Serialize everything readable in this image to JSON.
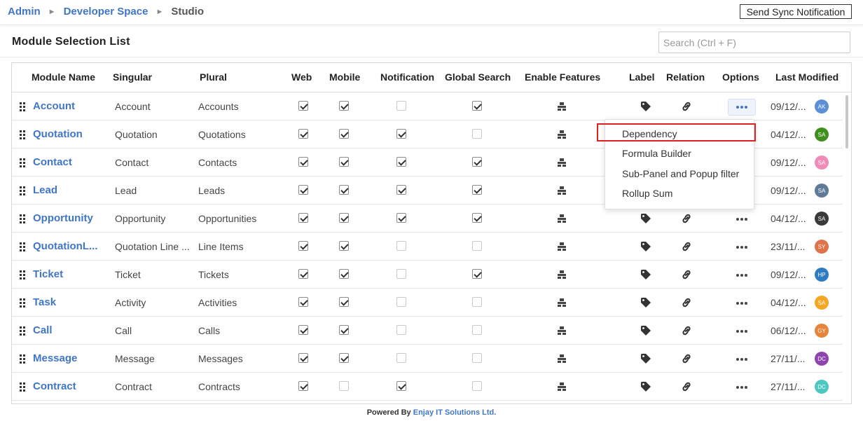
{
  "breadcrumb": [
    "Admin",
    "Developer Space",
    "Studio"
  ],
  "send_sync_label": "Send Sync Notification",
  "page_title": "Module Selection List",
  "search_placeholder": "Search (Ctrl + F)",
  "columns": [
    "Module Name",
    "Singular",
    "Plural",
    "Web",
    "Mobile",
    "Notification",
    "Global Search",
    "Enable Features",
    "Label",
    "Relation",
    "Options",
    "Last Modified"
  ],
  "rows": [
    {
      "name": "Account",
      "singular": "Account",
      "plural": "Accounts",
      "web": true,
      "mobile": true,
      "notification": false,
      "global_search": true,
      "modified": "09/12/...",
      "initials": "AK",
      "avatar_color": "#5b8fd6"
    },
    {
      "name": "Quotation",
      "singular": "Quotation",
      "plural": "Quotations",
      "web": true,
      "mobile": true,
      "notification": true,
      "global_search": false,
      "modified": "04/12/...",
      "initials": "SA",
      "avatar_color": "#3f8f1f"
    },
    {
      "name": "Contact",
      "singular": "Contact",
      "plural": "Contacts",
      "web": true,
      "mobile": true,
      "notification": true,
      "global_search": true,
      "modified": "09/12/...",
      "initials": "SA",
      "avatar_color": "#f28ab8"
    },
    {
      "name": "Lead",
      "singular": "Lead",
      "plural": "Leads",
      "web": true,
      "mobile": true,
      "notification": true,
      "global_search": true,
      "modified": "09/12/...",
      "initials": "SA",
      "avatar_color": "#5f7a99"
    },
    {
      "name": "Opportunity",
      "singular": "Opportunity",
      "plural": "Opportunities",
      "web": true,
      "mobile": true,
      "notification": true,
      "global_search": true,
      "modified": "04/12/...",
      "initials": "SA",
      "avatar_color": "#3a3a3a"
    },
    {
      "name": "QuotationL...",
      "singular": "Quotation Line ...",
      "plural": "Line Items",
      "web": true,
      "mobile": true,
      "notification": false,
      "global_search": false,
      "modified": "23/11/...",
      "initials": "SY",
      "avatar_color": "#e0734a"
    },
    {
      "name": "Ticket",
      "singular": "Ticket",
      "plural": "Tickets",
      "web": true,
      "mobile": true,
      "notification": false,
      "global_search": true,
      "modified": "09/12/...",
      "initials": "HP",
      "avatar_color": "#2e7bc4"
    },
    {
      "name": "Task",
      "singular": "Activity",
      "plural": "Activities",
      "web": true,
      "mobile": true,
      "notification": false,
      "global_search": false,
      "modified": "04/12/...",
      "initials": "SA",
      "avatar_color": "#f5a623"
    },
    {
      "name": "Call",
      "singular": "Call",
      "plural": "Calls",
      "web": true,
      "mobile": true,
      "notification": false,
      "global_search": false,
      "modified": "06/12/...",
      "initials": "GY",
      "avatar_color": "#e8833a"
    },
    {
      "name": "Message",
      "singular": "Message",
      "plural": "Messages",
      "web": true,
      "mobile": true,
      "notification": false,
      "global_search": false,
      "modified": "27/11/...",
      "initials": "DC",
      "avatar_color": "#8e44ad"
    },
    {
      "name": "Contract",
      "singular": "Contract",
      "plural": "Contracts",
      "web": true,
      "mobile": false,
      "notification": true,
      "global_search": false,
      "modified": "27/11/...",
      "initials": "DC",
      "avatar_color": "#4dc8c0"
    }
  ],
  "options_menu": [
    "Dependency",
    "Formula Builder",
    "Sub-Panel and Popup filter",
    "Rollup Sum"
  ],
  "footer": {
    "prefix": "Powered By ",
    "company": "Enjay IT Solutions Ltd."
  },
  "colors": {
    "link": "#3f76c6",
    "highlight": "#e02020"
  }
}
